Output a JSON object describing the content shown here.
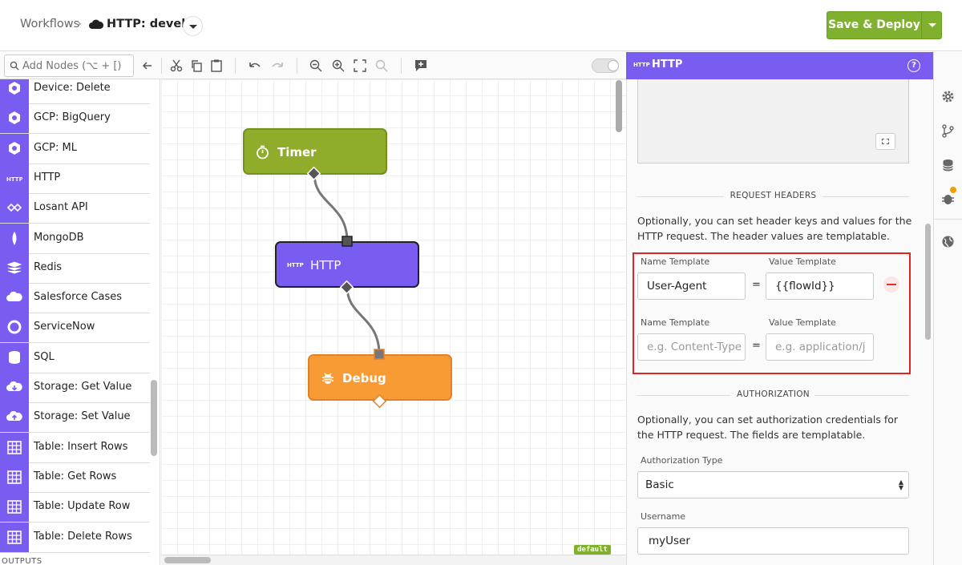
{
  "header": {
    "breadcrumb_root": "Workflows",
    "breadcrumb_sep": "›",
    "workflow_title": "HTTP: develop",
    "deploy_label": "Save & Deploy"
  },
  "toolbar": {
    "search_placeholder": "Add Nodes (⌥ + [)"
  },
  "palette": {
    "items": [
      {
        "label": "Device: Delete",
        "icon": "device-delete-icon"
      },
      {
        "label": "GCP: BigQuery",
        "icon": "gcp-bigquery-icon"
      },
      {
        "label": "GCP: ML",
        "icon": "gcp-ml-icon"
      },
      {
        "label": "HTTP",
        "icon": "http-icon"
      },
      {
        "label": "Losant API",
        "icon": "losant-api-icon"
      },
      {
        "label": "MongoDB",
        "icon": "mongodb-icon"
      },
      {
        "label": "Redis",
        "icon": "redis-icon"
      },
      {
        "label": "Salesforce Cases",
        "icon": "salesforce-icon"
      },
      {
        "label": "ServiceNow",
        "icon": "servicenow-icon"
      },
      {
        "label": "SQL",
        "icon": "database-icon"
      },
      {
        "label": "Storage: Get Value",
        "icon": "cloud-download-icon"
      },
      {
        "label": "Storage: Set Value",
        "icon": "cloud-upload-icon"
      },
      {
        "label": "Table: Insert Rows",
        "icon": "table-insert-icon"
      },
      {
        "label": "Table: Get Rows",
        "icon": "table-get-icon"
      },
      {
        "label": "Table: Update Row",
        "icon": "table-update-icon"
      },
      {
        "label": "Table: Delete Rows",
        "icon": "table-delete-icon"
      }
    ],
    "outputs_label": "OUTPUTS"
  },
  "canvas": {
    "nodes": {
      "timer": "Timer",
      "http": "HTTP",
      "http_icon_text": "HTTP",
      "debug": "Debug"
    },
    "default_badge": "default"
  },
  "panel": {
    "title": "HTTP",
    "title_icon_text": "HTTP",
    "help": "?",
    "request_headers": {
      "title": "REQUEST HEADERS",
      "description": "Optionally, you can set header keys and values for the HTTP request. The header values are templatable.",
      "name_label": "Name Template",
      "value_label": "Value Template",
      "equals": "=",
      "rows": [
        {
          "name": "User-Agent",
          "value": "{{flowId}}"
        },
        {
          "name_placeholder": "e.g. Content-Type",
          "value_placeholder": "e.g. application/j"
        }
      ]
    },
    "authorization": {
      "title": "AUTHORIZATION",
      "description": "Optionally, you can set authorization credentials for the HTTP request. The fields are templatable.",
      "type_label": "Authorization Type",
      "type_value": "Basic",
      "username_label": "Username",
      "username_value": "myUser"
    }
  },
  "colors": {
    "accent": "#7b5cf0",
    "deploy_green": "#7fb12f",
    "timer_green": "#8fad2a",
    "debug_orange": "#f99b35",
    "highlight_red": "#e02424"
  }
}
